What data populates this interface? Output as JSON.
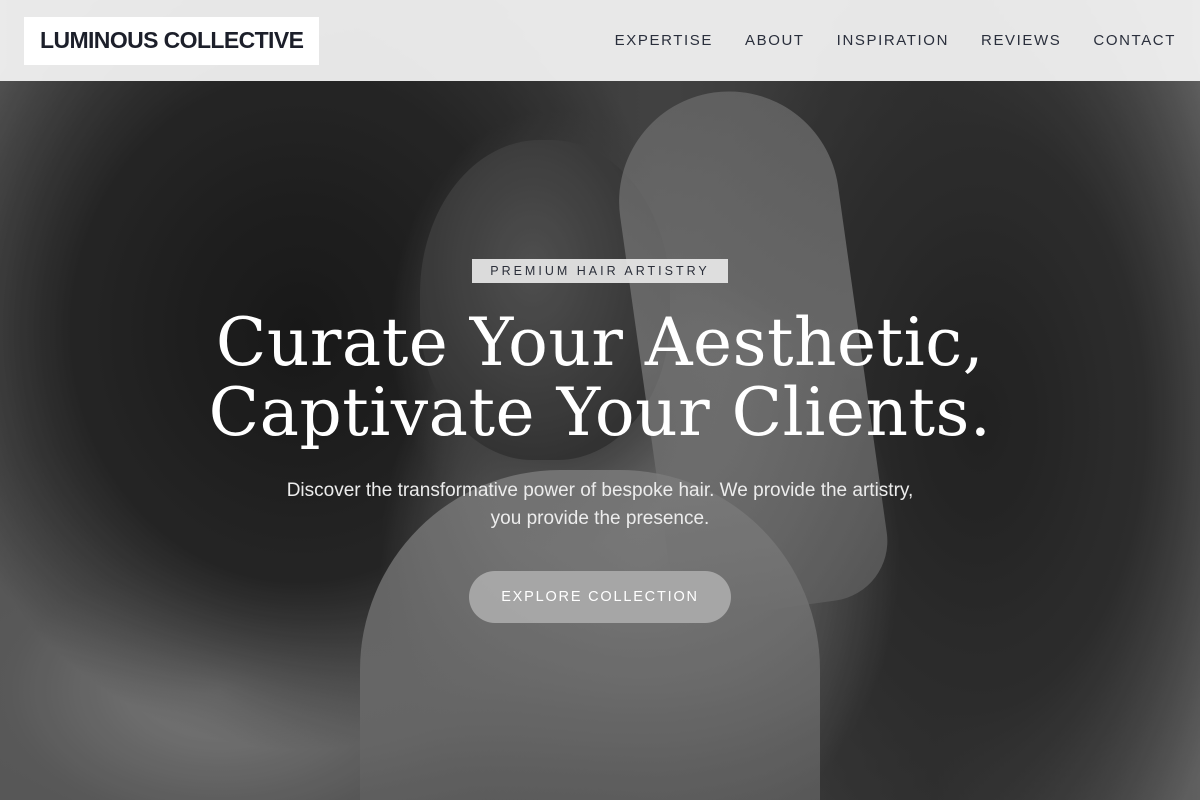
{
  "header": {
    "brand": "LUMINOUS COLLECTIVE",
    "nav": [
      {
        "label": "EXPERTISE"
      },
      {
        "label": "ABOUT"
      },
      {
        "label": "INSPIRATION"
      },
      {
        "label": "REVIEWS"
      },
      {
        "label": "CONTACT"
      }
    ]
  },
  "hero": {
    "eyebrow": "PREMIUM HAIR ARTISTRY",
    "headline_line1": "Curate Your Aesthetic,",
    "headline_line2": "Captivate Your Clients.",
    "subtext": "Discover the transformative power of bespoke hair. We provide the artistry, you provide the presence.",
    "cta_label": "EXPLORE COLLECTION"
  },
  "colors": {
    "header_bg": "#f5f5f5",
    "brand_text": "#1c1f2a",
    "headline_text": "#ffffff",
    "cta_bg": "#aaaaaa"
  }
}
